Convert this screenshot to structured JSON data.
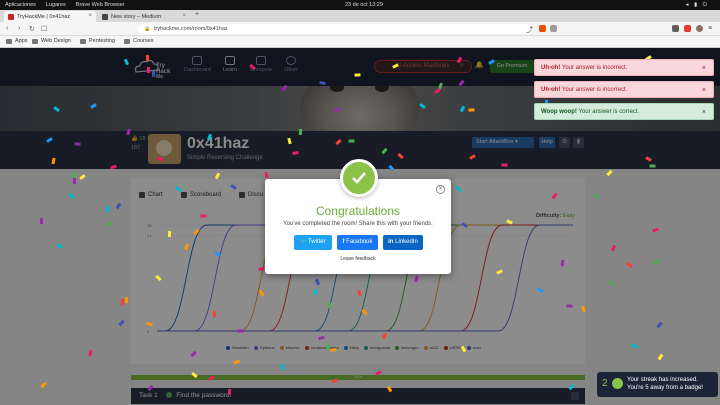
{
  "os_bar": {
    "apps": "Aplicaciones",
    "places": "Lugares",
    "browser": "Brave Web Browser",
    "clock": "23 de oct  13:29"
  },
  "tabs": [
    {
      "label": "TryHackMe | 0x41haz",
      "active": true,
      "favicon_color": "#c62828"
    },
    {
      "label": "New story – Medium",
      "active": false,
      "favicon_color": "#444444"
    }
  ],
  "url": "tryhackme.com/room/0x41haz",
  "bookmarks": [
    "Apps",
    "Web Design",
    "Pentesting",
    "Courses"
  ],
  "site_nav": {
    "logo": "TryHackMe",
    "items": [
      "Dashboard",
      "Learn",
      "Compete",
      "Other"
    ],
    "access_machines": "Access Machines",
    "premium": "Go Premium"
  },
  "room": {
    "title": "0x41haz",
    "subtitle": "Simple Reversing Challenge",
    "stats": [
      "18",
      "187"
    ],
    "start_attackbox": "Start AttackBox",
    "help": "Help"
  },
  "content_tabs": [
    "Chart",
    "Scoreboard",
    "Discu"
  ],
  "difficulty_label": "Difficulty:",
  "difficulty_value": "Easy",
  "chart_data": {
    "type": "line",
    "ylim": [
      0,
      30
    ],
    "yticks": [
      "30",
      "27",
      "0"
    ],
    "series": [
      {
        "name": "Wardlaim",
        "color": "#1565c0",
        "start": 0.02
      },
      {
        "name": "Optimus",
        "color": "#7b68ee",
        "start": 0.09
      },
      {
        "name": "Maarizz",
        "color": "#e6a23c",
        "start": 0.2
      },
      {
        "name": "mr.akiraqdalese",
        "color": "#e53935",
        "start": 0.27
      },
      {
        "name": "Navy",
        "color": "#1e88e5",
        "start": 0.38
      },
      {
        "name": "tomrguesta",
        "color": "#26a69a",
        "start": 0.46
      },
      {
        "name": "lavhergan",
        "color": "#43a047",
        "start": 0.55
      },
      {
        "name": "a222",
        "color": "#e6a23c",
        "start": 0.63
      },
      {
        "name": "vrff789",
        "color": "#d32f2f",
        "start": 0.73
      },
      {
        "name": "wuzi",
        "color": "#5c6bc0",
        "start": 0.82
      }
    ]
  },
  "progress_text": "100%",
  "task": {
    "label": "Task 1",
    "title": "Find the password!"
  },
  "modal": {
    "title": "Congratulations",
    "text": "You've completed the room! Share this with your friends:",
    "twitter": "Twitter",
    "facebook": "Facebook",
    "linkedin": "LinkedIn",
    "feedback": "Leave feedback",
    "colors": {
      "twitter": "#1da1f2",
      "facebook": "#1877f2",
      "linkedin": "#0a66c2",
      "success": "#8bc34a"
    }
  },
  "toasts": [
    {
      "type": "err",
      "title": "Uh-oh!",
      "message": "Your answer is incorrect."
    },
    {
      "type": "err",
      "title": "Uh-oh!",
      "message": "Your answer is incorrect."
    },
    {
      "type": "ok",
      "title": "Woop woop!",
      "message": "Your answer is correct."
    }
  ],
  "streak": {
    "count": "2",
    "line1": "Your streak has increased.",
    "line2": "You're 5 away from a badge!"
  }
}
